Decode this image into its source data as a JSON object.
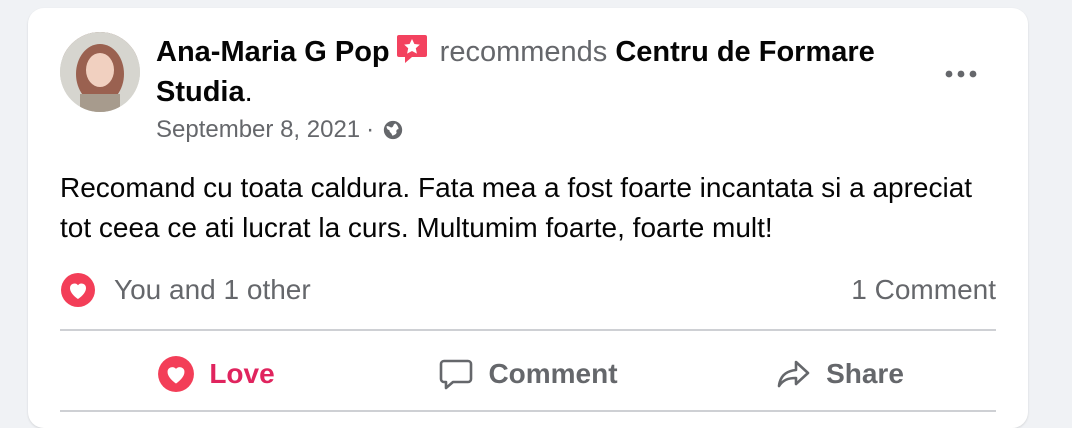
{
  "post": {
    "author": "Ana-Maria G Pop",
    "verb": "recommends",
    "page": "Centru de Formare Studia",
    "period": ".",
    "date": "September 8, 2021",
    "separator": "·",
    "text": "Recomand cu toata caldura. Fata mea a fost foarte incantata si a apreciat tot ceea ce ati lucrat la curs. Multumim foarte, foarte mult!"
  },
  "stats": {
    "reactions_label": "You and 1 other",
    "comments_label": "1 Comment"
  },
  "actions": {
    "love_label": "Love",
    "comment_label": "Comment",
    "share_label": "Share"
  },
  "icons": {
    "badge": "recommend-badge-icon",
    "audience": "globe-icon",
    "menu": "more-options-icon",
    "reaction": "heart-reaction-icon",
    "comment": "comment-icon",
    "share": "share-icon"
  },
  "colors": {
    "love": "#e0245e",
    "text": "#050505",
    "muted": "#65676b",
    "divider": "#ced0d4"
  }
}
